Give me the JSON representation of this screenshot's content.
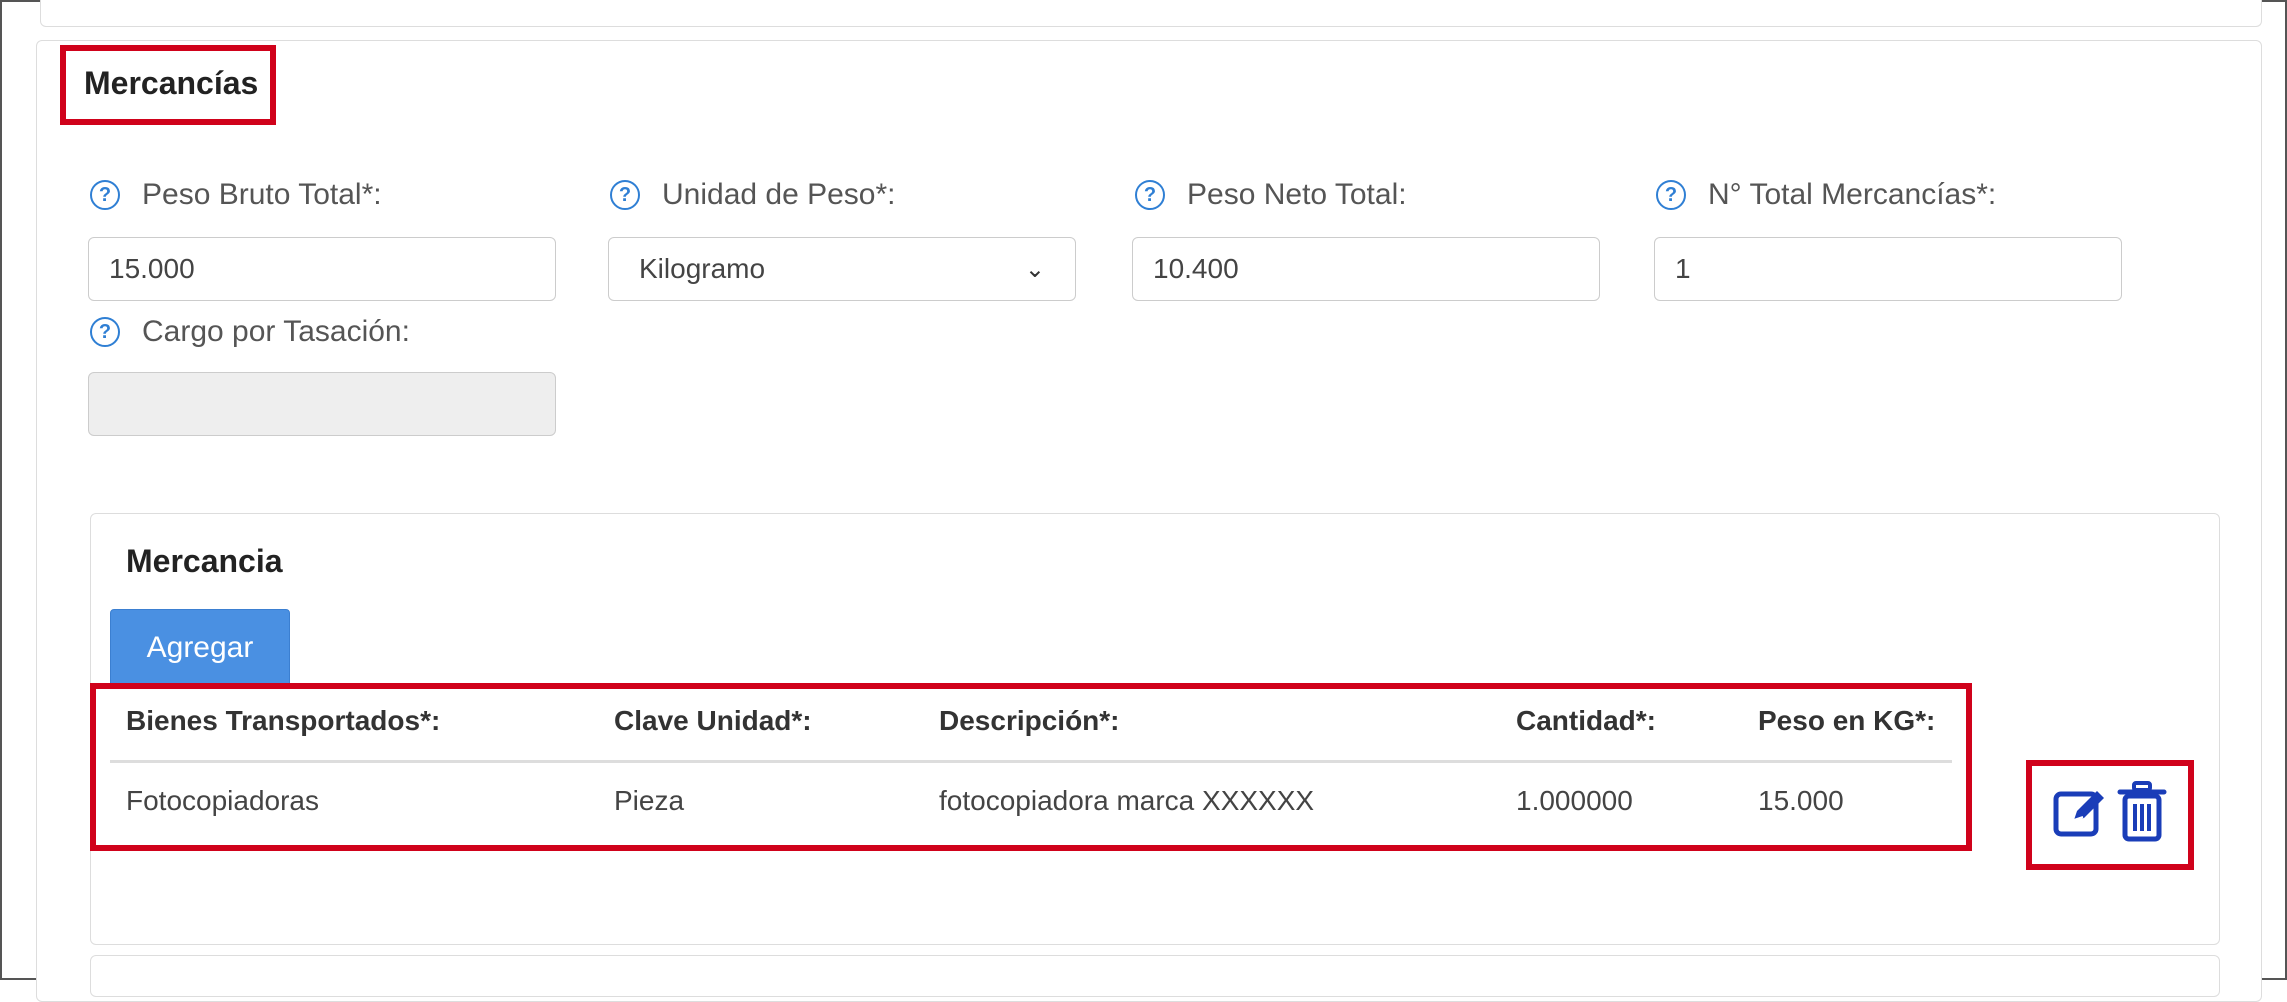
{
  "section": {
    "title": "Mercancías"
  },
  "fields": {
    "peso_bruto": {
      "label": "Peso Bruto Total*:",
      "value": "15.000"
    },
    "unidad_peso": {
      "label": "Unidad de Peso*:",
      "value": "Kilogramo"
    },
    "peso_neto": {
      "label": "Peso Neto Total:",
      "value": "10.400"
    },
    "total_mercancias": {
      "label": "N° Total Mercancías*:",
      "value": "1"
    },
    "cargo_tasacion": {
      "label": "Cargo por Tasación:",
      "value": ""
    }
  },
  "help_icon_glyph": "?",
  "mercancia": {
    "title": "Mercancia",
    "add_button": "Agregar",
    "columns": [
      "Bienes Transportados*:",
      "Clave Unidad*:",
      "Descripción*:",
      "Cantidad*:",
      "Peso en KG*:"
    ],
    "rows": [
      [
        "Fotocopiadoras",
        "Pieza",
        "fotocopiadora marca XXXXXX",
        "1.000000",
        "15.000"
      ]
    ]
  },
  "colors": {
    "highlight": "#d0021b",
    "accent": "#4a90e2",
    "icon": "#1a3db8"
  },
  "icons": {
    "edit": "edit-icon",
    "delete": "trash-icon"
  }
}
